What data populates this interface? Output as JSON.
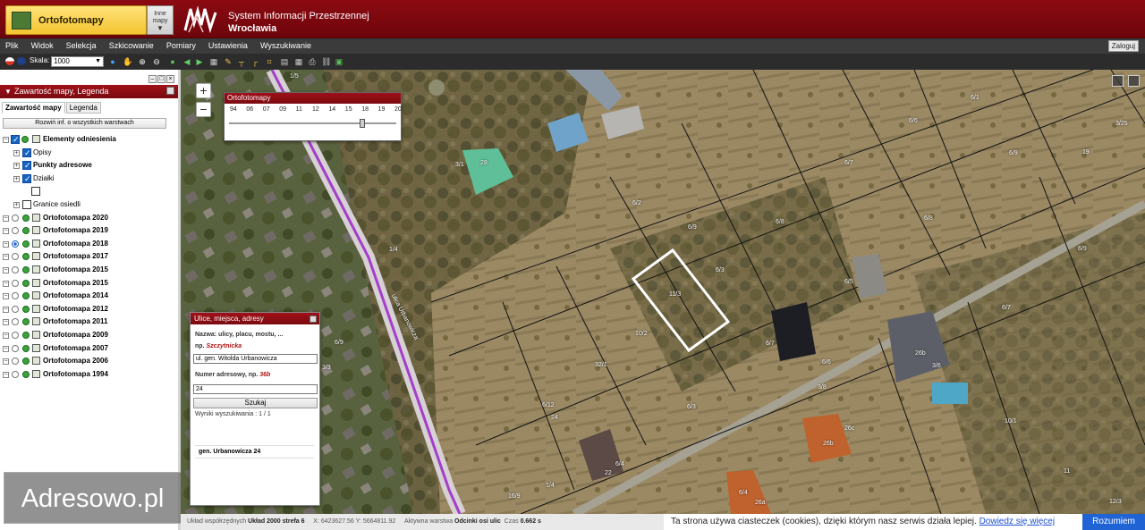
{
  "header": {
    "map_select_label": "Ortofotomapy",
    "other_maps_label_1": "Inne",
    "other_maps_label_2": "mapy",
    "system_title_line1": "System Informacji Przestrzennej",
    "system_title_line2": "Wrocławia"
  },
  "menu": {
    "items": [
      "Plik",
      "Widok",
      "Selekcja",
      "Szkicowanie",
      "Pomiary",
      "Ustawienia",
      "Wyszukiwanie"
    ],
    "login": "Zaloguj"
  },
  "toolbar": {
    "scale_label": "Skala:",
    "scale_value": "1000"
  },
  "left_panel": {
    "title": "Zawartość mapy, Legenda",
    "tabs": [
      "Zawartość mapy",
      "Legenda"
    ],
    "expand_all": "Rozwiń inf. o wszystkich warstwach",
    "tree": [
      {
        "label": "Elementy odniesienia",
        "bold": true,
        "level": 0,
        "kind": "group",
        "checked": true
      },
      {
        "label": "Opisy",
        "bold": false,
        "level": 1,
        "kind": "check",
        "checked": true
      },
      {
        "label": "Punkty adresowe",
        "bold": true,
        "level": 1,
        "kind": "check",
        "checked": true
      },
      {
        "label": "Działki",
        "bold": false,
        "level": 1,
        "kind": "check",
        "checked": true
      },
      {
        "label": "",
        "bold": false,
        "level": 2,
        "kind": "emptycheck",
        "checked": false
      },
      {
        "label": "Granice osiedli",
        "bold": false,
        "level": 1,
        "kind": "check",
        "checked": false
      },
      {
        "label": "Ortofotomapa 2020",
        "bold": true,
        "level": 0,
        "kind": "radio",
        "checked": false
      },
      {
        "label": "Ortofotomapa 2019",
        "bold": true,
        "level": 0,
        "kind": "radio",
        "checked": false
      },
      {
        "label": "Ortofotomapa 2018",
        "bold": true,
        "level": 0,
        "kind": "radio",
        "checked": true
      },
      {
        "label": "Ortofotomapa 2017",
        "bold": true,
        "level": 0,
        "kind": "radio",
        "checked": false
      },
      {
        "label": "Ortofotomapa 2015",
        "bold": true,
        "level": 0,
        "kind": "radio",
        "checked": false
      },
      {
        "label": "Ortofotomapa 2015",
        "bold": true,
        "level": 0,
        "kind": "radio",
        "checked": false
      },
      {
        "label": "Ortofotomapa 2014",
        "bold": true,
        "level": 0,
        "kind": "radio",
        "checked": false
      },
      {
        "label": "Ortofotomapa 2012",
        "bold": true,
        "level": 0,
        "kind": "radio",
        "checked": false
      },
      {
        "label": "Ortofotomapa 2011",
        "bold": true,
        "level": 0,
        "kind": "radio",
        "checked": false
      },
      {
        "label": "Ortofotomapa 2009",
        "bold": true,
        "level": 0,
        "kind": "radio",
        "checked": false
      },
      {
        "label": "Ortofotomapa 2007",
        "bold": true,
        "level": 0,
        "kind": "radio",
        "checked": false
      },
      {
        "label": "Ortofotomapa 2006",
        "bold": true,
        "level": 0,
        "kind": "radio",
        "checked": false
      },
      {
        "label": "Ortofotomapa 1994",
        "bold": true,
        "level": 0,
        "kind": "radio",
        "checked": false
      }
    ]
  },
  "watermark": "Adresowo.pl",
  "ortho_slider": {
    "title": "Ortofotomapy",
    "years": [
      "94",
      "06",
      "07",
      "09",
      "11",
      "12",
      "14",
      "15",
      "18",
      "19",
      "20"
    ],
    "selected": "18"
  },
  "search": {
    "title": "Ulice, miejsca, adresy",
    "street_label": "Nazwa: ulicy, placu, mostu, ...",
    "street_hint_prefix": "np.",
    "street_hint_example": "Szczytnicka",
    "street_value": "ul. gen. Witolda Urbanowicza",
    "number_label": "Numer adresowy, np.",
    "number_hint_example": "36b",
    "number_value": "24",
    "search_button": "Szukaj",
    "results_text": "Wyniki wyszukiwania : 1 / 1",
    "result_item": "gen. Urbanowicza 24"
  },
  "map_labels": [
    "1/5",
    "6/1",
    "6/6",
    "3/25",
    "3/1",
    "28",
    "6/7",
    "6/9",
    "19",
    "6/2",
    "6/8",
    "6/8",
    "6/9",
    "6/9",
    "6/3",
    "6/5",
    "11/3",
    "6/7",
    "6/7",
    "10/2",
    "6/6",
    "1/4",
    "26b",
    "3/6",
    "32/1",
    "6/9",
    "3/8",
    "6/12",
    "24",
    "6/3",
    "10/1",
    "22",
    "6/4",
    "26c",
    "26b",
    "6/4",
    "26a",
    "11",
    "12/3",
    "3/3",
    "16/9",
    "1/4"
  ],
  "street_name": "ulica Urbanowicza",
  "status_bar": {
    "coord_label": "Układ współrzędnych",
    "coord_system": "Układ 2000 strefa 6",
    "coords": "X: 6423627.56 Y: 5664811.92",
    "active_layer_label": "Aktywna warstwa",
    "active_layer": "Odcinki osi ulic",
    "time_label": "Czas",
    "time_value": "0.662 s"
  },
  "cookie": {
    "text": "Ta strona używa ciasteczek (cookies), dzięki którym nasz serwis działa lepiej.",
    "link": "Dowiedz się więcej",
    "button": "Rozumiem"
  }
}
